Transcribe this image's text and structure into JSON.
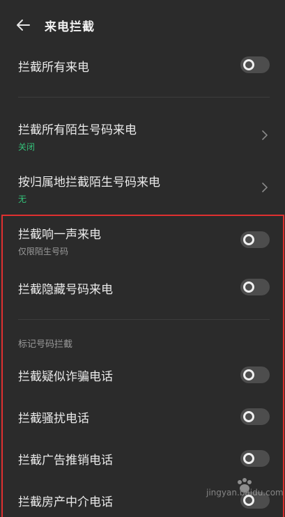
{
  "header": {
    "title": "来电拦截"
  },
  "rows": {
    "block_all": {
      "title": "拦截所有来电"
    },
    "block_unknown": {
      "title": "拦截所有陌生号码来电",
      "subtitle": "关闭"
    },
    "block_by_location": {
      "title": "按归属地拦截陌生号码来电",
      "subtitle": "无"
    },
    "block_one_ring": {
      "title": "拦截响一声来电",
      "subtitle": "仅限陌生号码"
    },
    "block_hidden": {
      "title": "拦截隐藏号码来电"
    }
  },
  "marked_section": {
    "label": "标记号码拦截",
    "items": [
      {
        "title": "拦截疑似诈骗电话"
      },
      {
        "title": "拦截骚扰电话"
      },
      {
        "title": "拦截广告推销电话"
      },
      {
        "title": "拦截房产中介电话"
      }
    ]
  },
  "watermark": {
    "text": "jingyan.baidu.com"
  },
  "colors": {
    "background": "#2b2b2b",
    "accent_green": "#34c27a",
    "highlight_border": "#e03030",
    "toggle_off": "#4d4d4d"
  }
}
